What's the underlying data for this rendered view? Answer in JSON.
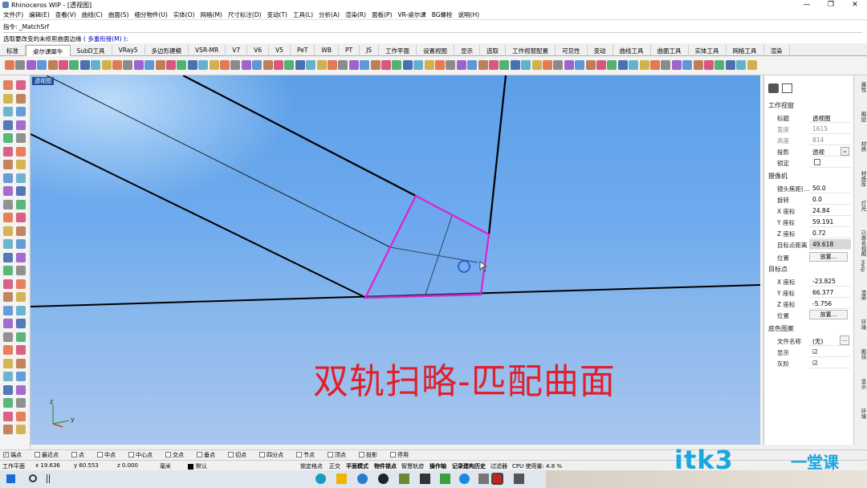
{
  "window": {
    "title": "Rhinoceros WIP - [透视图]",
    "controls": [
      "—",
      "❐",
      "✕"
    ]
  },
  "menu": [
    "文件(F)",
    "编辑(E)",
    "查看(V)",
    "曲线(C)",
    "曲面(S)",
    "细分物件(U)",
    "实体(O)",
    "网格(M)",
    "尺寸标注(D)",
    "变动(T)",
    "工具(L)",
    "分析(A)",
    "渲染(R)",
    "面板(P)",
    "VR-桌尔课",
    "BG螺栓",
    "说明(H)"
  ],
  "command": {
    "history": "指令: _MatchSrf",
    "prompt": "选取要改变的未修剪曲面边缘",
    "option": "( 多重衔接(M) ):"
  },
  "tabs": [
    "标准",
    "桌尔课犀牛",
    "SubD工具",
    "VRay5",
    "多边形建模",
    "VSR-MR",
    "V7",
    "V6",
    "V5",
    "PeT",
    "WB",
    "PT",
    "JS",
    "工作平面",
    "设置视图",
    "显示",
    "选取",
    "工作视窗配置",
    "可见性",
    "变动",
    "曲线工具",
    "曲面工具",
    "实体工具",
    "网格工具",
    "渲染"
  ],
  "active_tab": "桌尔课犀牛",
  "viewport": {
    "label": "透视图",
    "overlay_text": "双轨扫略-匹配曲面",
    "axis_labels": [
      "z",
      "y",
      "x"
    ]
  },
  "properties": {
    "section_viewport": "工作视窗",
    "viewport_rows": [
      {
        "key": "标题",
        "value": "透视图",
        "dim": false
      },
      {
        "key": "宽度",
        "value": "1615",
        "dim": true
      },
      {
        "key": "高度",
        "value": "814",
        "dim": true
      },
      {
        "key": "投影",
        "value": "透视",
        "dim": false
      },
      {
        "key": "锁定",
        "value": "",
        "dim": false
      }
    ],
    "section_camera": "摄像机",
    "camera_rows": [
      {
        "key": "镜头焦距(...",
        "value": "50.0"
      },
      {
        "key": "旋转",
        "value": "0.0"
      },
      {
        "key": "X 座标",
        "value": "24.84"
      },
      {
        "key": "Y 座标",
        "value": "59.191"
      },
      {
        "key": "Z 座标",
        "value": "0.72"
      },
      {
        "key": "目标点距离",
        "value": "49.618"
      }
    ],
    "camera_position_label": "位置",
    "place_button": "放置...",
    "section_target": "目标点",
    "target_rows": [
      {
        "key": "X 座标",
        "value": "-23.825"
      },
      {
        "key": "Y 座标",
        "value": "66.377"
      },
      {
        "key": "Z 座标",
        "value": "-5.756"
      }
    ],
    "target_position_label": "位置",
    "section_wallpaper": "底色图案",
    "wallpaper_rows": [
      {
        "key": "文件名称",
        "value": "(无)"
      },
      {
        "key": "显示",
        "value": "☑"
      },
      {
        "key": "灰阶",
        "value": "☑"
      }
    ],
    "browse_button": "..."
  },
  "side_tabs": [
    "属性",
    "图层",
    "材质",
    "材质库",
    "灯光",
    "已命名视图",
    "Help",
    "渲染",
    "环境",
    "图块",
    "显示",
    "环境"
  ],
  "osnap": [
    {
      "label": "端点",
      "checked": true
    },
    {
      "label": "最近点",
      "checked": false
    },
    {
      "label": "点",
      "checked": false
    },
    {
      "label": "中点",
      "checked": false
    },
    {
      "label": "中心点",
      "checked": false
    },
    {
      "label": "交点",
      "checked": false
    },
    {
      "label": "垂点",
      "checked": false
    },
    {
      "label": "切点",
      "checked": false
    },
    {
      "label": "四分点",
      "checked": false
    },
    {
      "label": "节点",
      "checked": false
    },
    {
      "label": "顶点",
      "checked": false
    },
    {
      "label": "投影",
      "checked": false
    },
    {
      "label": "停用",
      "checked": false
    }
  ],
  "status": {
    "cplane": "工作平面",
    "x": "x 19.636",
    "y": "y 60.553",
    "z": "z 0.000",
    "units": "毫米",
    "layer": "默认",
    "grid_snap": "锁定格点",
    "ortho": "正交",
    "planar": "平面模式",
    "osnap": "物件锁点",
    "smarttrack": "智慧轨迹",
    "gumball": "操作轴",
    "history": "记录建构历史",
    "filter": "过滤器",
    "cpu": "CPU 使用量: 4.8 %"
  },
  "watermark": {
    "main": "itk3",
    "sub": "一堂课",
    "dot": "."
  },
  "colors": {
    "accent": "#1e4f9e",
    "selection": "#e020d0",
    "overlay": "#e0202a",
    "watermark": "#1aa7e0"
  }
}
